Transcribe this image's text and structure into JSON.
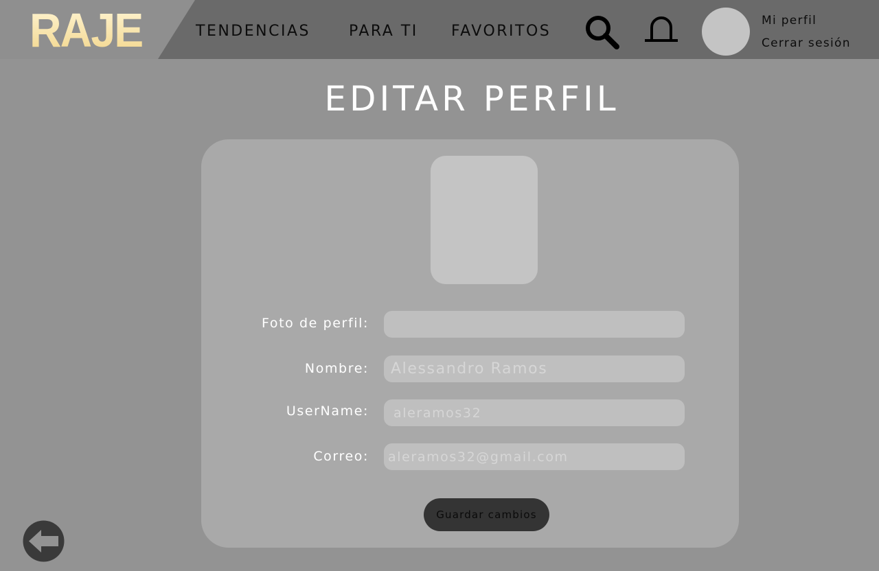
{
  "header": {
    "logo_text": "RAJE",
    "nav": [
      {
        "label": "TENDENCIAS"
      },
      {
        "label": "PARA TI"
      },
      {
        "label": "FAVORITOS"
      }
    ],
    "icons": {
      "search": "search-icon",
      "notifications": "bell-icon"
    },
    "user_menu": {
      "profile_label": "Mi perfil",
      "logout_label": "Cerrar sesión"
    }
  },
  "page": {
    "title": "EDITAR PERFIL"
  },
  "form": {
    "photo_label": "Foto de perfil:",
    "photo_value": "",
    "name_label": "Nombre:",
    "name_placeholder": "Alessandro Ramos",
    "username_label": "UserName:",
    "username_placeholder": "aleramos32",
    "email_label": "Correo:",
    "email_placeholder": "aleramos32@gmail.com",
    "save_label": "Guardar cambios"
  },
  "footer": {
    "back_icon": "arrow-left-icon"
  },
  "colors": {
    "background": "#939393",
    "header": "#6a6a6a",
    "card": "#a9a9a9",
    "input": "#bfbfbf",
    "button": "#343434",
    "logo": "#f8e3a8"
  }
}
